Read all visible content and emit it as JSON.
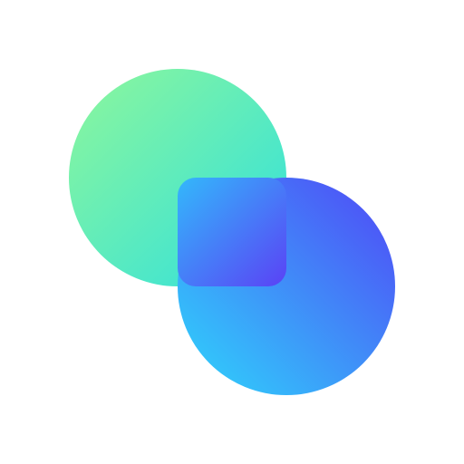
{
  "logo": {
    "icon_name": "overlapping-circles-logo-icon",
    "colors": {
      "background": "#ffffff",
      "top_circle_gradient": [
        "#8ef79b",
        "#2ee0de"
      ],
      "bottom_circle_gradient": [
        "#2ed7fb",
        "#5145f6"
      ],
      "overlap_gradient": [
        "#33b8fb",
        "#5a42f5"
      ]
    }
  }
}
